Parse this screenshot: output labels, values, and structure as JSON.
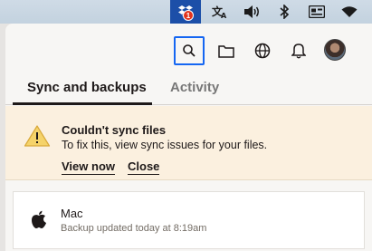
{
  "menubar": {
    "dropbox_badge": "1",
    "icons": [
      "dropbox-icon",
      "translate-icon",
      "volume-icon",
      "bluetooth-icon",
      "keyboard-icon",
      "wifi-icon"
    ]
  },
  "toolbar": {
    "icons": [
      "search-icon",
      "folder-icon",
      "globe-icon",
      "bell-icon",
      "avatar"
    ],
    "focus_color": "#1566f2"
  },
  "tabs": [
    {
      "label": "Sync and backups",
      "active": true
    },
    {
      "label": "Activity",
      "active": false
    }
  ],
  "alert": {
    "title": "Couldn't sync files",
    "body": "To fix this, view sync issues for your files.",
    "primary_link": "View now",
    "secondary_link": "Close",
    "background": "#fbf0df",
    "icon_color": "#f5d36a"
  },
  "device": {
    "name": "Mac",
    "status": "Backup updated today at 8:19am"
  }
}
